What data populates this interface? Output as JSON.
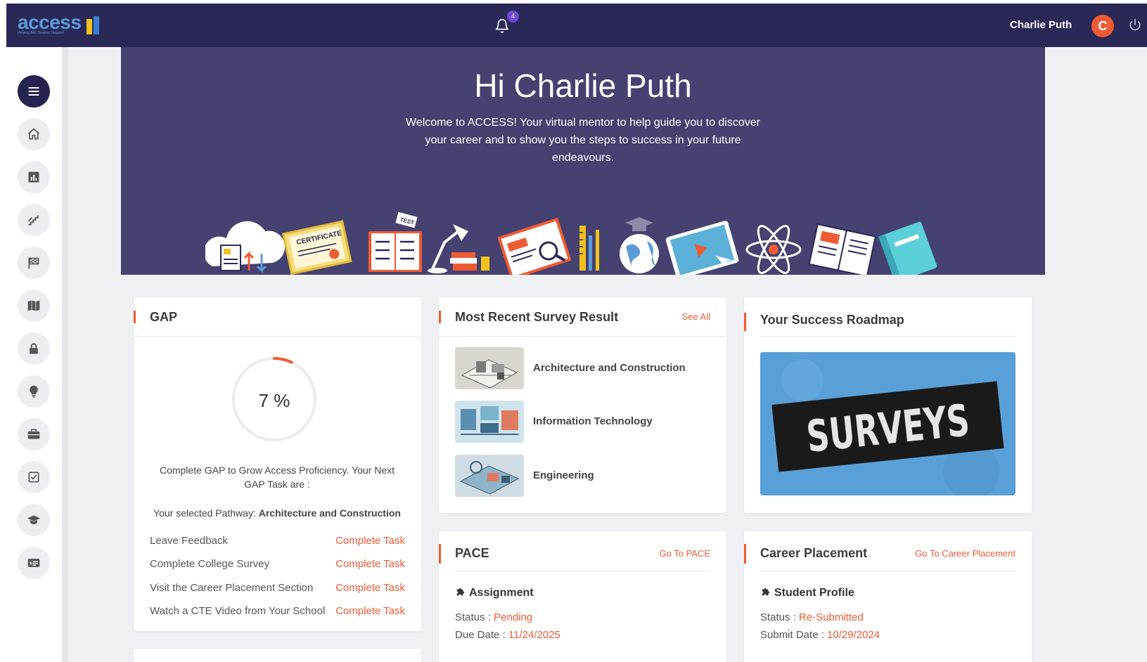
{
  "app": {
    "logo_text": "access",
    "logo_tagline": "Helping BIG Dreams Happen!",
    "notification_count": "4",
    "user_name": "Charlie Puth",
    "avatar_initial": "C"
  },
  "colors": {
    "nav": "#2a2857",
    "hero": "#454170",
    "accent": "#ef5b34"
  },
  "sidebar": {
    "items": [
      {
        "icon": "menu-icon"
      },
      {
        "icon": "home-icon"
      },
      {
        "icon": "chart-icon"
      },
      {
        "icon": "stairs-icon"
      },
      {
        "icon": "flag-icon"
      },
      {
        "icon": "map-icon"
      },
      {
        "icon": "lock-icon"
      },
      {
        "icon": "lightbulb-icon"
      },
      {
        "icon": "briefcase-icon"
      },
      {
        "icon": "checkbox-icon"
      },
      {
        "icon": "graduation-cap-icon"
      },
      {
        "icon": "id-card-icon"
      }
    ]
  },
  "hero": {
    "greeting": "Hi Charlie Puth",
    "message": "Welcome to ACCESS! Your virtual mentor to help guide you to discover your career and to show you the steps to success in your future endeavours.",
    "art_text": {
      "certificate": "CERTIFICATE",
      "test": "TEST"
    }
  },
  "gap": {
    "title": "GAP",
    "progress_label": "7 %",
    "progress_fraction": 0.07,
    "description": "Complete GAP to Grow Access Proficiency. Your Next GAP Task are :",
    "pathway_prefix": "Your selected Pathway: ",
    "pathway": "Architecture and Construction",
    "tasks": [
      {
        "name": "Leave Feedback",
        "action": "Complete Task"
      },
      {
        "name": "Complete College Survey",
        "action": "Complete Task"
      },
      {
        "name": "Visit the Career Placement Section",
        "action": "Complete Task"
      },
      {
        "name": "Watch a CTE Video from Your School",
        "action": "Complete Task"
      }
    ]
  },
  "survey": {
    "title": "Most Recent Survey Result",
    "see_all": "See All",
    "items": [
      {
        "label": "Architecture and Construction"
      },
      {
        "label": "Information Technology"
      },
      {
        "label": "Engineering"
      }
    ]
  },
  "roadmap": {
    "title": "Your Success Roadmap",
    "image_text": "SURVEYS"
  },
  "pace": {
    "title": "PACE",
    "link": "Go To PACE",
    "section": "Assignment",
    "status_label": "Status : ",
    "status": "Pending",
    "due_label": "Due Date : ",
    "due": "11/24/2025"
  },
  "career": {
    "title": "Career Placement",
    "link": "Go To Career Placement",
    "section": "Student Profile",
    "status_label": "Status : ",
    "status": "Re-Submitted",
    "submit_label": "Submit Date : ",
    "submit": "10/29/2024"
  }
}
